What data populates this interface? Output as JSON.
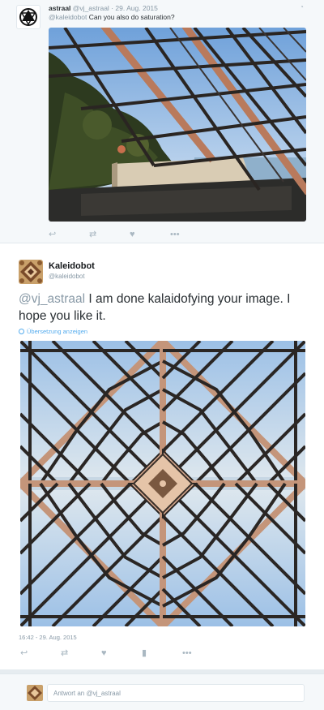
{
  "parent_tweet": {
    "name": "astraal",
    "handle": "@vj_astraal",
    "separator": "·",
    "date": "29. Aug. 2015",
    "mention": "@kaleidobot",
    "text": "Can you also do saturation?"
  },
  "main_tweet": {
    "name": "Kaleidobot",
    "handle": "@kaleidobot",
    "mention": "@vj_astraal",
    "text": "I am done kalaidofying your image. I hope you like it.",
    "translate_label": "Übersetzung anzeigen",
    "timestamp": "16:42 - 29. Aug. 2015"
  },
  "reply_box": {
    "prefix": "Antwort an",
    "mention": "@vj_astraal"
  },
  "actions": {
    "reply_icon": "↩",
    "retweet_icon": "⇄",
    "like_icon": "♥",
    "stats_icon": "▮",
    "more_icon": "•••"
  },
  "colors": {
    "background": "#e6ecf0",
    "muted": "#8899a6",
    "link": "#55acee",
    "icon": "#aab8c2"
  }
}
